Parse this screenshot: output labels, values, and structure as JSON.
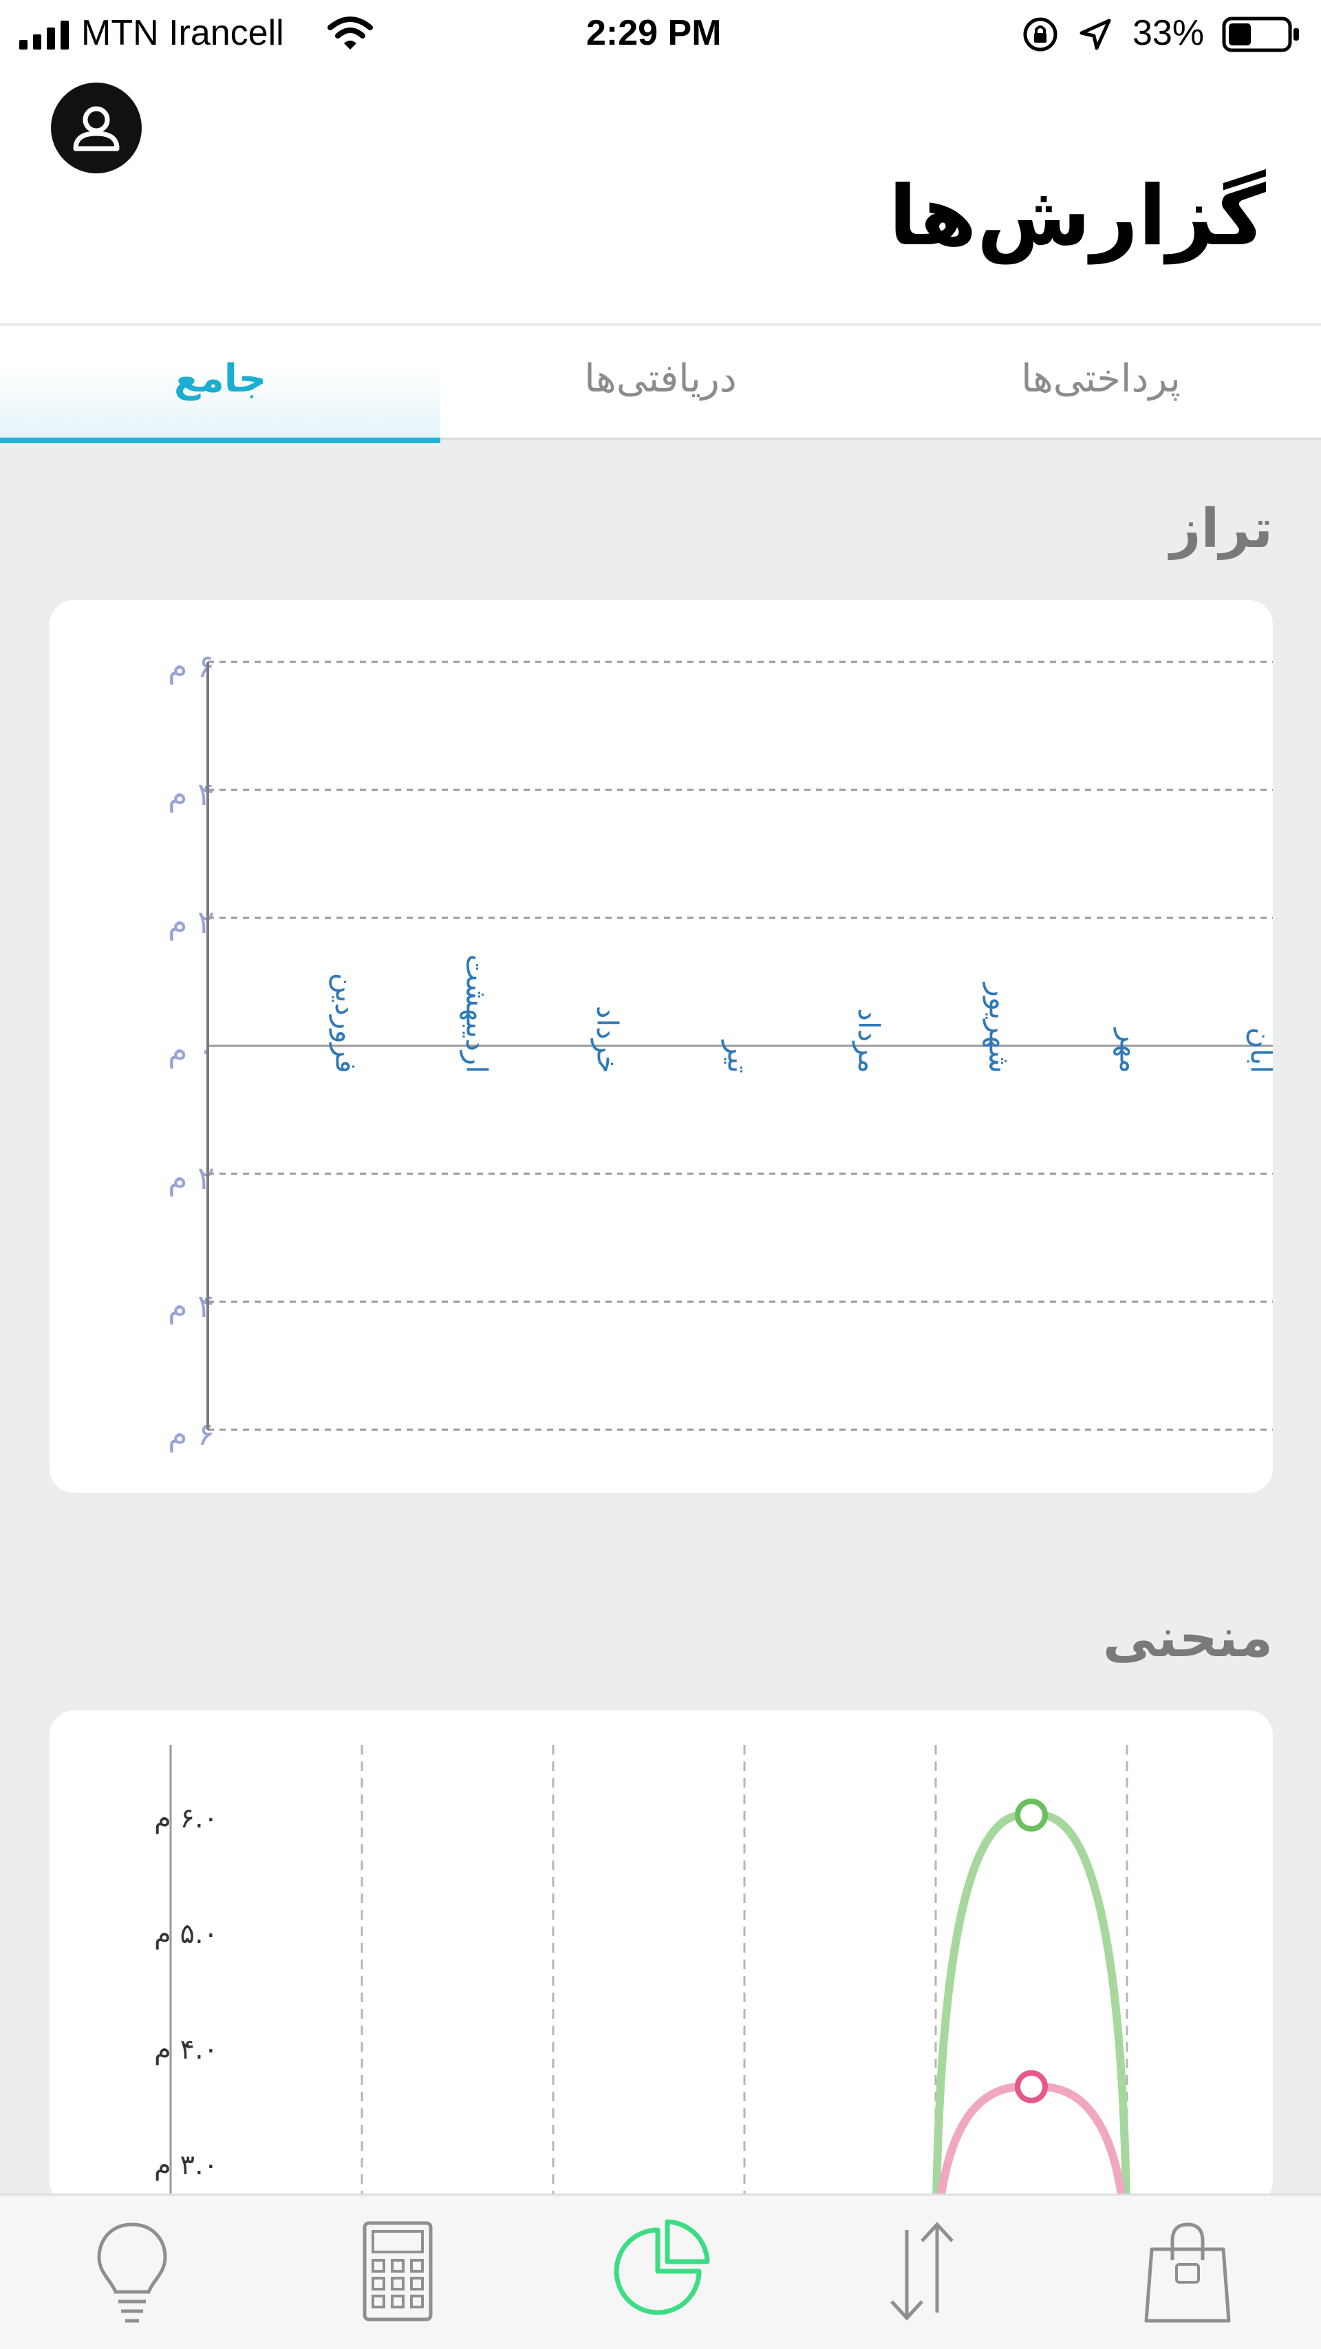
{
  "status_bar": {
    "carrier": "MTN Irancell",
    "time": "2:29 PM",
    "battery": "33%",
    "icons": [
      "signal-bars-icon",
      "wifi-icon",
      "orientation-lock-icon",
      "location-arrow-icon",
      "battery-icon"
    ]
  },
  "header": {
    "title": "گزارش‌ها",
    "avatar_icon": "user-icon"
  },
  "tabs": [
    {
      "label": "پرداختی‌ها",
      "active": false
    },
    {
      "label": "دریافتی‌ها",
      "active": false
    },
    {
      "label": "جامع",
      "active": true
    }
  ],
  "sections": {
    "balance_title": "تراز",
    "curve_title": "منحنی"
  },
  "chart_data": [
    {
      "type": "bar",
      "title": "تراز",
      "categories": [
        "فروردین",
        "اردیبهشت",
        "خرداد",
        "تیر",
        "مرداد",
        "شهریور",
        "مهر",
        "آبان"
      ],
      "values": [
        0,
        0,
        0,
        0,
        0,
        0,
        0,
        0
      ],
      "y_ticks": [
        "۶ م",
        "۴ م",
        "۲ م",
        "۰ م",
        "۲ م",
        "۴ م",
        "۶ م"
      ],
      "y_tick_values": [
        6,
        4,
        2,
        0,
        -2,
        -4,
        -6
      ],
      "ylim": [
        -6,
        6
      ],
      "grid": true,
      "colors": {
        "tick": "#9aa3d6",
        "category": "#2f79b8",
        "grid": "#9a9a9a"
      }
    },
    {
      "type": "line",
      "title": "منحنی",
      "x_columns": 6,
      "y_ticks": [
        "۶.۰ م",
        "۵.۰ م",
        "۴.۰ م",
        "۳.۰ م"
      ],
      "y_tick_values": [
        6.0,
        5.0,
        4.0,
        3.0
      ],
      "ylim_visible": [
        2.9,
        7.0
      ],
      "series": [
        {
          "color": "#a6d89e",
          "marker_color": "#6bbf5e",
          "points": [
            {
              "x": 4.0,
              "y": 2.0
            },
            {
              "x": 4.5,
              "y": 6.0
            },
            {
              "x": 5.0,
              "y": 2.0
            }
          ]
        },
        {
          "color": "#f2a7c0",
          "marker_color": "#e8578a",
          "points": [
            {
              "x": 4.0,
              "y": 2.0
            },
            {
              "x": 4.5,
              "y": 3.65
            },
            {
              "x": 5.0,
              "y": 2.0
            }
          ]
        }
      ]
    }
  ],
  "bottom_nav": [
    {
      "icon": "lightbulb-icon",
      "active": false
    },
    {
      "icon": "calculator-icon",
      "active": false
    },
    {
      "icon": "pie-chart-icon",
      "active": true
    },
    {
      "icon": "transfer-arrows-icon",
      "active": false
    },
    {
      "icon": "shopping-bag-icon",
      "active": false
    }
  ],
  "colors": {
    "accent": "#1fb5d6",
    "active_nav": "#3ddc84",
    "inactive_nav": "#8f8f8f"
  }
}
